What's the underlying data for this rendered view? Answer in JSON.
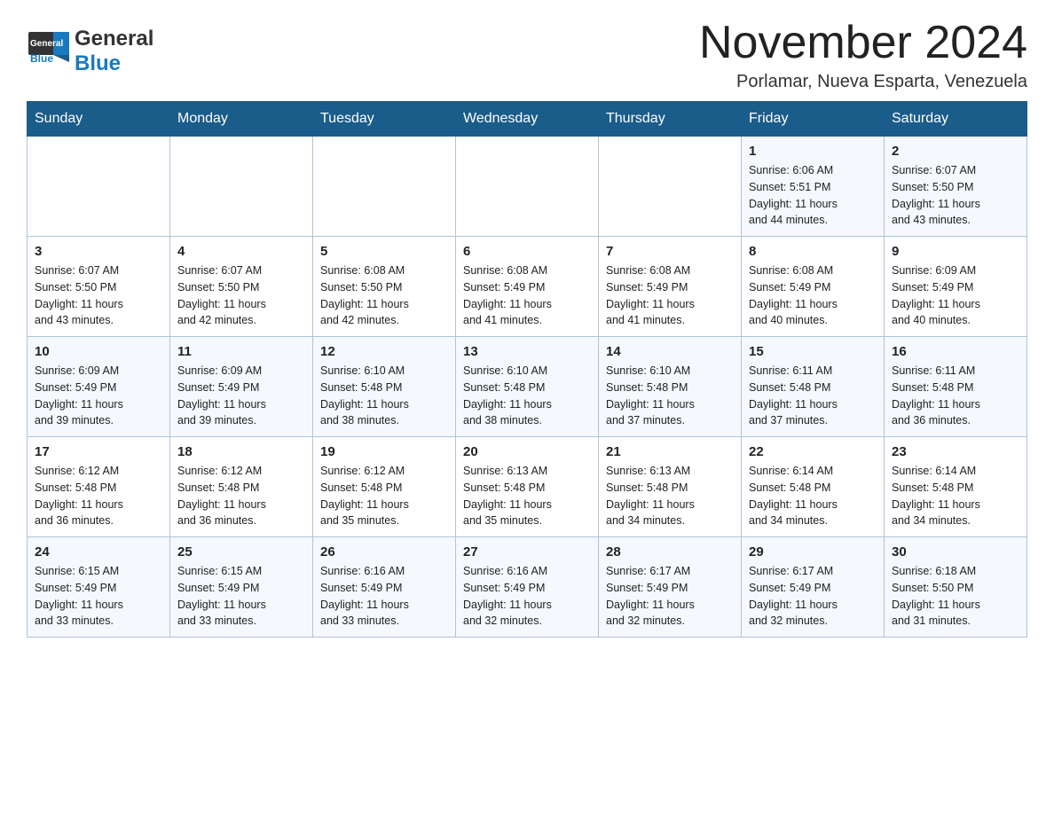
{
  "header": {
    "logo_text_general": "General",
    "logo_text_blue": "Blue",
    "month_title": "November 2024",
    "location": "Porlamar, Nueva Esparta, Venezuela"
  },
  "calendar": {
    "days_of_week": [
      "Sunday",
      "Monday",
      "Tuesday",
      "Wednesday",
      "Thursday",
      "Friday",
      "Saturday"
    ],
    "weeks": [
      [
        {
          "day": "",
          "info": ""
        },
        {
          "day": "",
          "info": ""
        },
        {
          "day": "",
          "info": ""
        },
        {
          "day": "",
          "info": ""
        },
        {
          "day": "",
          "info": ""
        },
        {
          "day": "1",
          "info": "Sunrise: 6:06 AM\nSunset: 5:51 PM\nDaylight: 11 hours\nand 44 minutes."
        },
        {
          "day": "2",
          "info": "Sunrise: 6:07 AM\nSunset: 5:50 PM\nDaylight: 11 hours\nand 43 minutes."
        }
      ],
      [
        {
          "day": "3",
          "info": "Sunrise: 6:07 AM\nSunset: 5:50 PM\nDaylight: 11 hours\nand 43 minutes."
        },
        {
          "day": "4",
          "info": "Sunrise: 6:07 AM\nSunset: 5:50 PM\nDaylight: 11 hours\nand 42 minutes."
        },
        {
          "day": "5",
          "info": "Sunrise: 6:08 AM\nSunset: 5:50 PM\nDaylight: 11 hours\nand 42 minutes."
        },
        {
          "day": "6",
          "info": "Sunrise: 6:08 AM\nSunset: 5:49 PM\nDaylight: 11 hours\nand 41 minutes."
        },
        {
          "day": "7",
          "info": "Sunrise: 6:08 AM\nSunset: 5:49 PM\nDaylight: 11 hours\nand 41 minutes."
        },
        {
          "day": "8",
          "info": "Sunrise: 6:08 AM\nSunset: 5:49 PM\nDaylight: 11 hours\nand 40 minutes."
        },
        {
          "day": "9",
          "info": "Sunrise: 6:09 AM\nSunset: 5:49 PM\nDaylight: 11 hours\nand 40 minutes."
        }
      ],
      [
        {
          "day": "10",
          "info": "Sunrise: 6:09 AM\nSunset: 5:49 PM\nDaylight: 11 hours\nand 39 minutes."
        },
        {
          "day": "11",
          "info": "Sunrise: 6:09 AM\nSunset: 5:49 PM\nDaylight: 11 hours\nand 39 minutes."
        },
        {
          "day": "12",
          "info": "Sunrise: 6:10 AM\nSunset: 5:48 PM\nDaylight: 11 hours\nand 38 minutes."
        },
        {
          "day": "13",
          "info": "Sunrise: 6:10 AM\nSunset: 5:48 PM\nDaylight: 11 hours\nand 38 minutes."
        },
        {
          "day": "14",
          "info": "Sunrise: 6:10 AM\nSunset: 5:48 PM\nDaylight: 11 hours\nand 37 minutes."
        },
        {
          "day": "15",
          "info": "Sunrise: 6:11 AM\nSunset: 5:48 PM\nDaylight: 11 hours\nand 37 minutes."
        },
        {
          "day": "16",
          "info": "Sunrise: 6:11 AM\nSunset: 5:48 PM\nDaylight: 11 hours\nand 36 minutes."
        }
      ],
      [
        {
          "day": "17",
          "info": "Sunrise: 6:12 AM\nSunset: 5:48 PM\nDaylight: 11 hours\nand 36 minutes."
        },
        {
          "day": "18",
          "info": "Sunrise: 6:12 AM\nSunset: 5:48 PM\nDaylight: 11 hours\nand 36 minutes."
        },
        {
          "day": "19",
          "info": "Sunrise: 6:12 AM\nSunset: 5:48 PM\nDaylight: 11 hours\nand 35 minutes."
        },
        {
          "day": "20",
          "info": "Sunrise: 6:13 AM\nSunset: 5:48 PM\nDaylight: 11 hours\nand 35 minutes."
        },
        {
          "day": "21",
          "info": "Sunrise: 6:13 AM\nSunset: 5:48 PM\nDaylight: 11 hours\nand 34 minutes."
        },
        {
          "day": "22",
          "info": "Sunrise: 6:14 AM\nSunset: 5:48 PM\nDaylight: 11 hours\nand 34 minutes."
        },
        {
          "day": "23",
          "info": "Sunrise: 6:14 AM\nSunset: 5:48 PM\nDaylight: 11 hours\nand 34 minutes."
        }
      ],
      [
        {
          "day": "24",
          "info": "Sunrise: 6:15 AM\nSunset: 5:49 PM\nDaylight: 11 hours\nand 33 minutes."
        },
        {
          "day": "25",
          "info": "Sunrise: 6:15 AM\nSunset: 5:49 PM\nDaylight: 11 hours\nand 33 minutes."
        },
        {
          "day": "26",
          "info": "Sunrise: 6:16 AM\nSunset: 5:49 PM\nDaylight: 11 hours\nand 33 minutes."
        },
        {
          "day": "27",
          "info": "Sunrise: 6:16 AM\nSunset: 5:49 PM\nDaylight: 11 hours\nand 32 minutes."
        },
        {
          "day": "28",
          "info": "Sunrise: 6:17 AM\nSunset: 5:49 PM\nDaylight: 11 hours\nand 32 minutes."
        },
        {
          "day": "29",
          "info": "Sunrise: 6:17 AM\nSunset: 5:49 PM\nDaylight: 11 hours\nand 32 minutes."
        },
        {
          "day": "30",
          "info": "Sunrise: 6:18 AM\nSunset: 5:50 PM\nDaylight: 11 hours\nand 31 minutes."
        }
      ]
    ]
  }
}
